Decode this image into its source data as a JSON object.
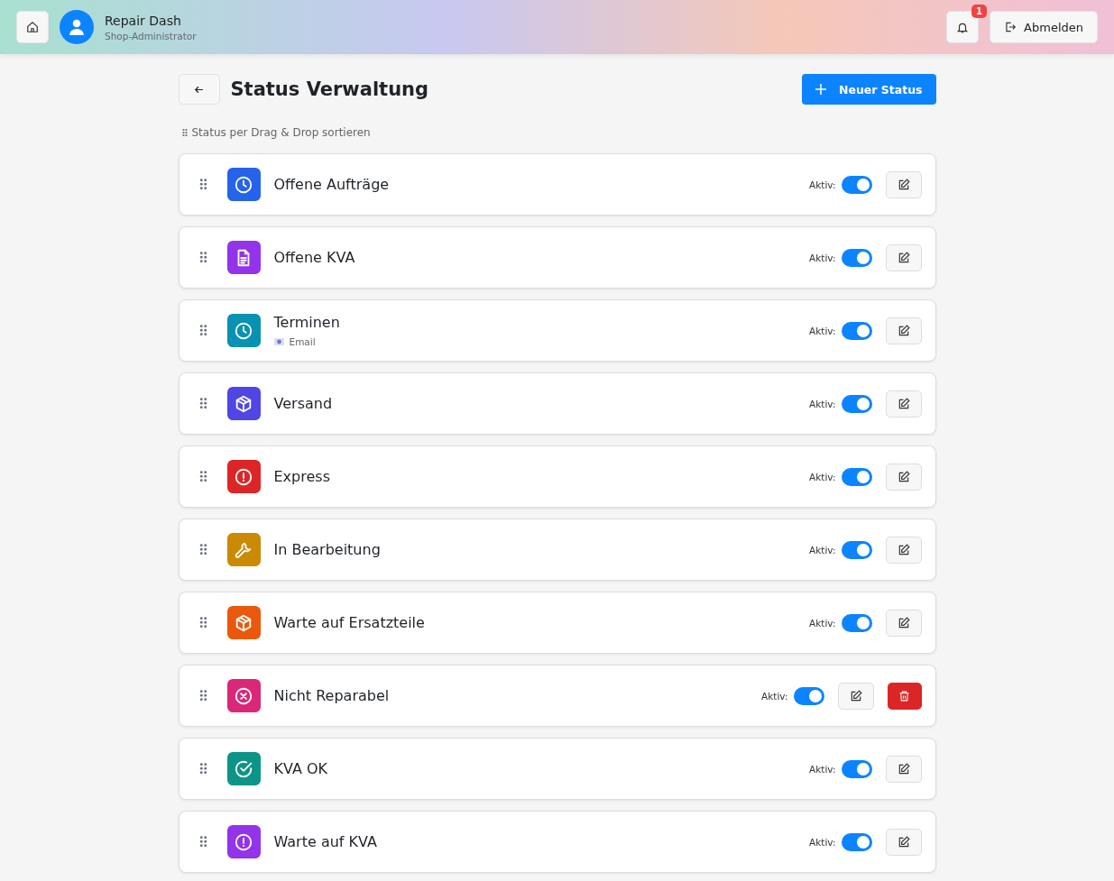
{
  "header": {
    "app_name": "Repair Dash",
    "role": "Shop-Administrator",
    "notification_count": "1",
    "logout_label": "Abmelden"
  },
  "page": {
    "title": "Status Verwaltung",
    "new_button": "Neuer Status",
    "hint": "Status per Drag & Drop sortieren"
  },
  "statuses": [
    {
      "name": "Offene Aufträge",
      "kind": "clock",
      "color": "#2563eb",
      "active_label": "Aktiv:",
      "active": true,
      "deletable": false
    },
    {
      "name": "Offene KVA",
      "kind": "document",
      "color": "#9333ea",
      "active_label": "Aktiv:",
      "active": true,
      "deletable": false
    },
    {
      "name": "Terminen",
      "kind": "clock",
      "color": "#0891b2",
      "active_label": "Aktiv:",
      "active": true,
      "deletable": false,
      "subtitle": "Email"
    },
    {
      "name": "Versand",
      "kind": "box",
      "color": "#4f46e5",
      "active_label": "Aktiv:",
      "active": true,
      "deletable": false
    },
    {
      "name": "Express",
      "kind": "alert",
      "color": "#dc2626",
      "active_label": "Aktiv:",
      "active": true,
      "deletable": false
    },
    {
      "name": "In Bearbeitung",
      "kind": "wrench",
      "color": "#ca8a04",
      "active_label": "Aktiv:",
      "active": true,
      "deletable": false
    },
    {
      "name": "Warte auf Ersatzteile",
      "kind": "box",
      "color": "#ea580c",
      "active_label": "Aktiv:",
      "active": true,
      "deletable": false
    },
    {
      "name": "Nicht Reparabel",
      "kind": "cross",
      "color": "#db2777",
      "active_label": "Aktiv:",
      "active": true,
      "deletable": true
    },
    {
      "name": "KVA OK",
      "kind": "check",
      "color": "#0d9488",
      "active_label": "Aktiv:",
      "active": true,
      "deletable": false
    },
    {
      "name": "Warte auf KVA",
      "kind": "alert",
      "color": "#9333ea",
      "active_label": "Aktiv:",
      "active": true,
      "deletable": false
    }
  ]
}
